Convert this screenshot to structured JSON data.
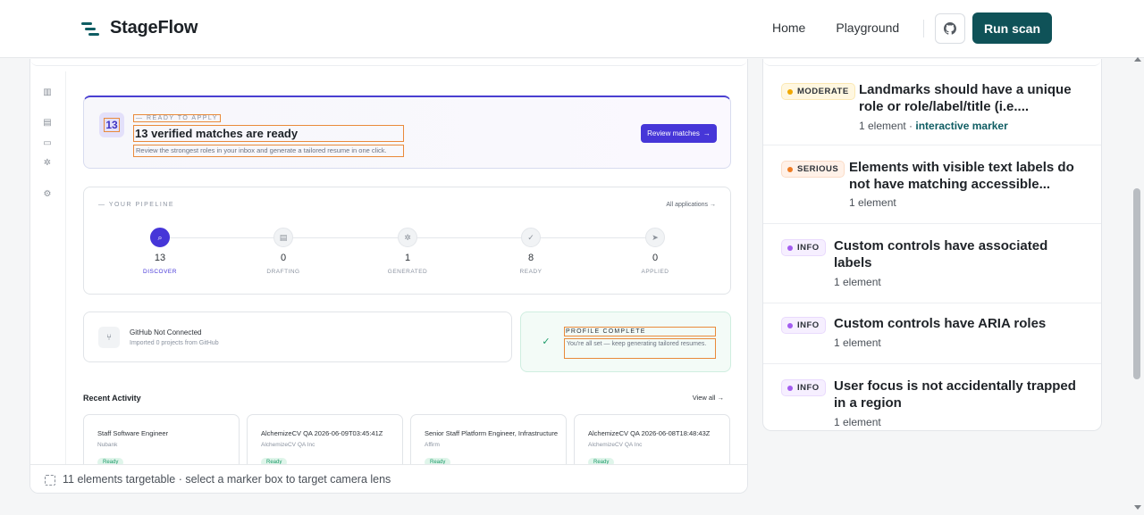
{
  "nav": {
    "brand": "StageFlow",
    "links": [
      "Home",
      "Playground"
    ],
    "run_label": "Run scan"
  },
  "hero": {
    "count_badge": "13",
    "eyebrow": "— READY TO APPLY",
    "title": "13 verified matches are ready",
    "subtitle": "Review the strongest roles in your inbox and generate a tailored resume in one click.",
    "button": "Review matches"
  },
  "pipeline": {
    "eyebrow": "— YOUR PIPELINE",
    "link": "All applications →",
    "stages": [
      {
        "count": "13",
        "label": "DISCOVER",
        "icon": "search-icon"
      },
      {
        "count": "0",
        "label": "DRAFTING",
        "icon": "document-icon"
      },
      {
        "count": "1",
        "label": "GENERATED",
        "icon": "sparkle-icon"
      },
      {
        "count": "8",
        "label": "READY",
        "icon": "check-circle-icon"
      },
      {
        "count": "0",
        "label": "APPLIED",
        "icon": "send-icon"
      }
    ]
  },
  "github_card": {
    "title": "GitHub Not Connected",
    "subtitle": "Imported 0 projects from GitHub"
  },
  "profile_card": {
    "title": "PROFILE COMPLETE",
    "subtitle": "You're all set — keep generating tailored resumes."
  },
  "recent": {
    "heading": "Recent Activity",
    "link": "View all",
    "items": [
      {
        "title": "Staff Software Engineer",
        "company": "Nubank",
        "status": "Ready"
      },
      {
        "title": "AlchemizeCV QA 2026-06-09T03:45:41Z",
        "company": "AlchemizeCV QA Inc",
        "status": "Ready"
      },
      {
        "title": "Senior Staff Platform Engineer, Infrastructure",
        "company": "Affirm",
        "status": "Ready"
      },
      {
        "title": "AlchemizeCV QA 2026-06-08T18:48:43Z",
        "company": "AlchemizeCV QA Inc",
        "status": "Ready"
      }
    ]
  },
  "footer": {
    "text": "11 elements targetable · select a marker box to target camera lens"
  },
  "issues": [
    {
      "severity": "MODERATE",
      "title": "Landmarks should have a unique role or role/label/title (i.e....",
      "meta": "1 element · ",
      "meta_link": "interactive marker"
    },
    {
      "severity": "SERIOUS",
      "title": "Elements with visible text labels do not have matching accessible...",
      "meta": "1 element",
      "meta_link": ""
    },
    {
      "severity": "INFO",
      "title": "Custom controls have associated labels",
      "meta": "1 element",
      "meta_link": ""
    },
    {
      "severity": "INFO",
      "title": "Custom controls have ARIA roles",
      "meta": "1 element",
      "meta_link": ""
    },
    {
      "severity": "INFO",
      "title": "User focus is not accidentally trapped in a region",
      "meta": "1 element",
      "meta_link": ""
    }
  ],
  "colors": {
    "brand_teal": "#0f5258",
    "accent_indigo": "#4636d8",
    "marker_orange": "#e98a3a",
    "moderate": "#f0a800",
    "serious": "#ee7b22",
    "info": "#a35cf0"
  }
}
